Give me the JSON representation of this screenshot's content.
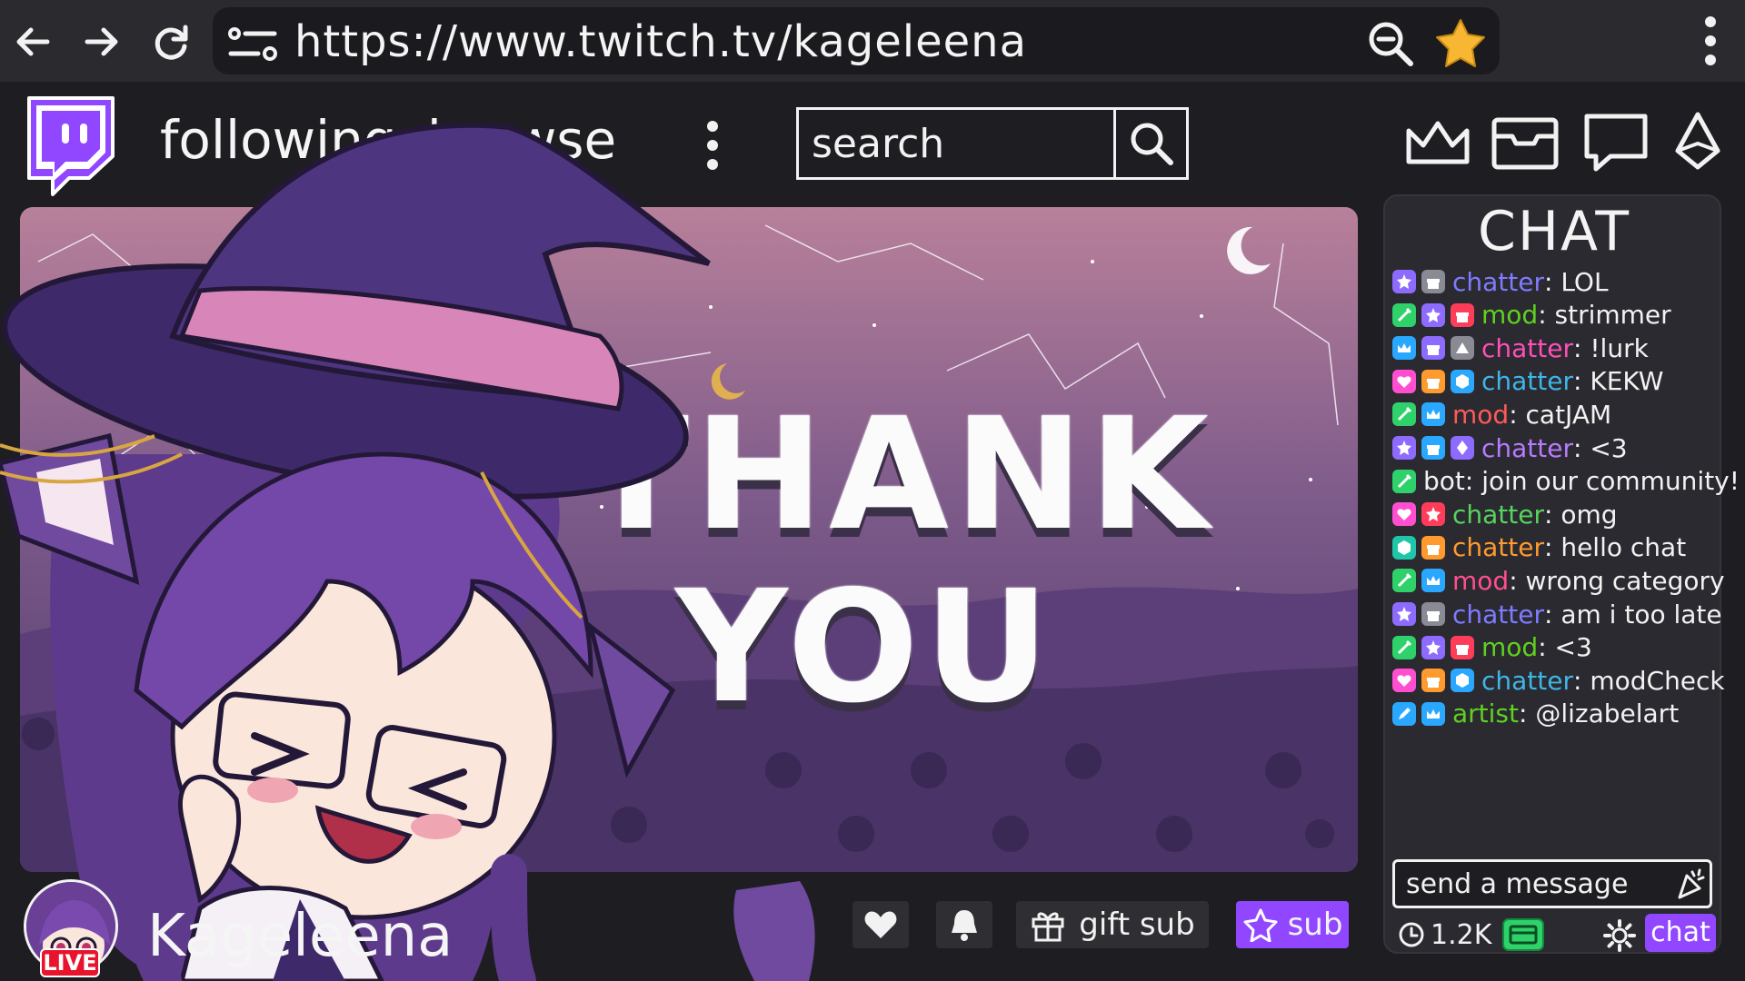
{
  "browser": {
    "url": "https://www.twitch.tv/kageleena",
    "icons": [
      "back-arrow-icon",
      "forward-arrow-icon",
      "reload-icon",
      "site-settings-icon",
      "zoom-out-icon",
      "bookmark-star-icon",
      "kebab-menu-icon"
    ]
  },
  "header": {
    "following": "following",
    "browse": "browse",
    "search_placeholder": "search",
    "icons": [
      "twitch-logo-icon",
      "crown-icon",
      "inbox-icon",
      "whispers-icon",
      "bits-gem-icon"
    ]
  },
  "stream": {
    "overlay_line1": "THANK",
    "overlay_line2": "YOU"
  },
  "channel": {
    "name": "Kageleena",
    "live": "LIVE"
  },
  "actions": {
    "gift_sub": "gift sub",
    "sub": "sub"
  },
  "chat": {
    "title": "CHAT",
    "messages": [
      {
        "badges": [
          "purple-star",
          "gray-gift"
        ],
        "user": "chatter",
        "color": "#7f7bff",
        "text": "LOL"
      },
      {
        "badges": [
          "green-sword",
          "purple-star",
          "red-gift"
        ],
        "user": "mod",
        "color": "#5fd11f",
        "text": "strimmer"
      },
      {
        "badges": [
          "blue-crown",
          "purple-gift",
          "gray-triangle"
        ],
        "user": "chatter",
        "color": "#ff4fb8",
        "text": "!lurk"
      },
      {
        "badges": [
          "pink-heart",
          "orange-gift",
          "blue-hexagon"
        ],
        "user": "chatter",
        "color": "#3fb6e8",
        "text": "KEKW"
      },
      {
        "badges": [
          "green-sword",
          "blue-crown"
        ],
        "user": "mod",
        "color": "#ff5a5a",
        "text": "catJAM"
      },
      {
        "badges": [
          "purple-star",
          "blue-gift",
          "purple-gem"
        ],
        "user": "chatter",
        "color": "#b87bff",
        "text": "<3"
      },
      {
        "badges": [
          "green-sword"
        ],
        "user": "bot",
        "color": "#f2f2f2",
        "text": "join our community!"
      },
      {
        "badges": [
          "pink-heart",
          "red-star"
        ],
        "user": "chatter",
        "color": "#58d35f",
        "text": "omg"
      },
      {
        "badges": [
          "teal-hexagon",
          "orange-gift"
        ],
        "user": "chatter",
        "color": "#ff9a2e",
        "text": "hello chat"
      },
      {
        "badges": [
          "green-sword",
          "blue-crown"
        ],
        "user": "mod",
        "color": "#ff4f8e",
        "text": "wrong category"
      },
      {
        "badges": [
          "purple-star",
          "gray-gift"
        ],
        "user": "chatter",
        "color": "#7f7bff",
        "text": "am i too late"
      },
      {
        "badges": [
          "green-sword",
          "purple-star",
          "red-gift"
        ],
        "user": "mod",
        "color": "#5fd11f",
        "text": "<3"
      },
      {
        "badges": [
          "pink-heart",
          "orange-gift",
          "blue-hexagon"
        ],
        "user": "chatter",
        "color": "#3fb6e8",
        "text": "modCheck"
      },
      {
        "badges": [
          "blue-pen",
          "blue-crown"
        ],
        "user": "artist",
        "color": "#5fd11f",
        "text": "@lizabelart"
      }
    ],
    "input_placeholder": "send a message",
    "viewers": "1.2K",
    "chat_button": "chat"
  },
  "colors": {
    "accent": "#9147ff",
    "live_red": "#e8142d",
    "background": "#1e1e22"
  }
}
